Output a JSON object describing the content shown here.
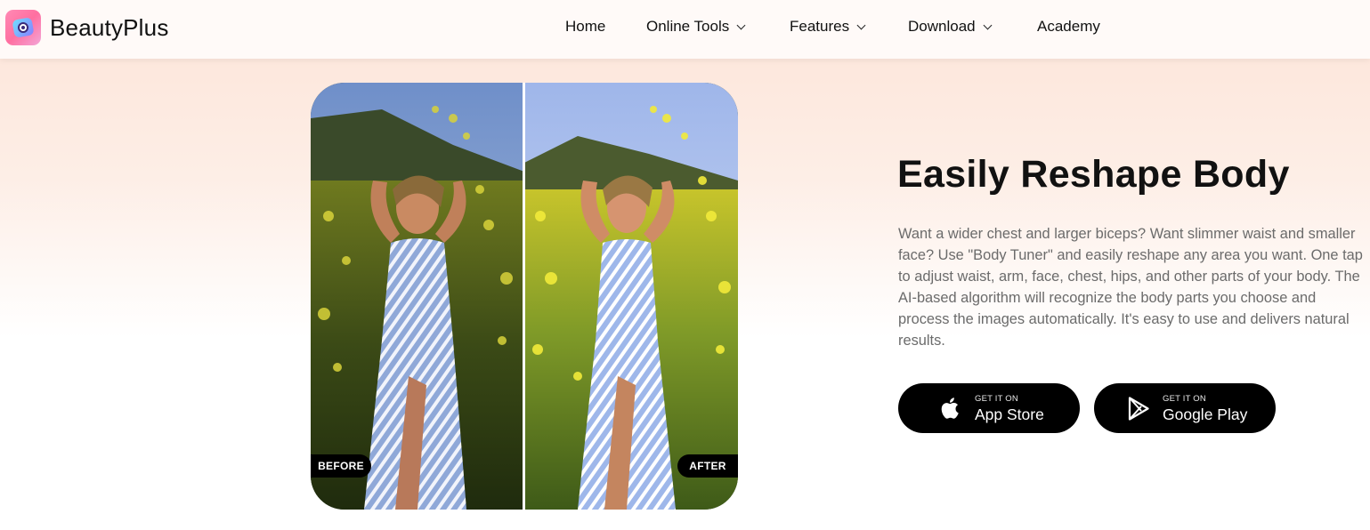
{
  "brand": {
    "name": "BeautyPlus"
  },
  "nav": {
    "items": [
      {
        "label": "Home",
        "dropdown": false
      },
      {
        "label": "Online Tools",
        "dropdown": true
      },
      {
        "label": "Features",
        "dropdown": true
      },
      {
        "label": "Download",
        "dropdown": true
      },
      {
        "label": "Academy",
        "dropdown": false
      }
    ]
  },
  "compare": {
    "before_label": "BEFORE",
    "after_label": "AFTER"
  },
  "hero": {
    "title": "Easily Reshape Body",
    "description": "Want a wider chest and larger biceps? Want slimmer waist and smaller face? Use \"Body Tuner\" and easily reshape any area you want. One tap to adjust waist, arm, face, chest, hips, and other parts of your body. The AI-based algorithm will recognize the body parts you choose and process the images automatically. It's easy to use and delivers natural results."
  },
  "stores": {
    "apple": {
      "small": "GET IT ON",
      "big": "App Store",
      "icon": "apple-icon"
    },
    "google": {
      "small": "GET IT ON",
      "big": "Google Play",
      "icon": "google-play-icon"
    }
  },
  "colors": {
    "accent_bg": "#fde4d8",
    "button_bg": "#000000",
    "text_muted": "#6b6b6b"
  }
}
